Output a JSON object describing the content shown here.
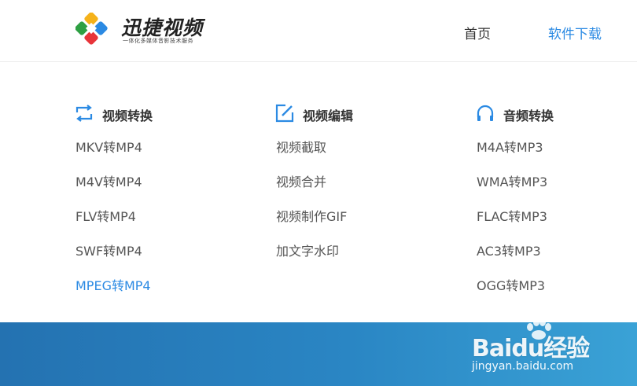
{
  "header": {
    "logo_title": "迅捷视频",
    "logo_slogan": "一体化多媒体音影技术服务",
    "nav": [
      {
        "label": "首页"
      },
      {
        "label": "软件下载"
      }
    ]
  },
  "columns": [
    {
      "title": "视频转换",
      "icon": "convert-arrows-icon",
      "items": [
        "MKV转MP4",
        "M4V转MP4",
        "FLV转MP4",
        "SWF转MP4",
        "MPEG转MP4"
      ],
      "active_item": "MPEG转MP4"
    },
    {
      "title": "视频编辑",
      "icon": "edit-pencil-icon",
      "items": [
        "视频截取",
        "视频合并",
        "视频制作GIF",
        "加文字水印"
      ]
    },
    {
      "title": "音频转换",
      "icon": "headphones-icon",
      "items": [
        "M4A转MP3",
        "WMA转MP3",
        "FLAC转MP3",
        "AC3转MP3",
        "OGG转MP3"
      ]
    }
  ],
  "watermark": {
    "brand": "Baidu经验",
    "url": "jingyan.baidu.com"
  },
  "colors": {
    "accent": "#2b8ae3",
    "text": "#555555",
    "banner_start": "#2472b1",
    "banner_end": "#3aa2d6"
  }
}
